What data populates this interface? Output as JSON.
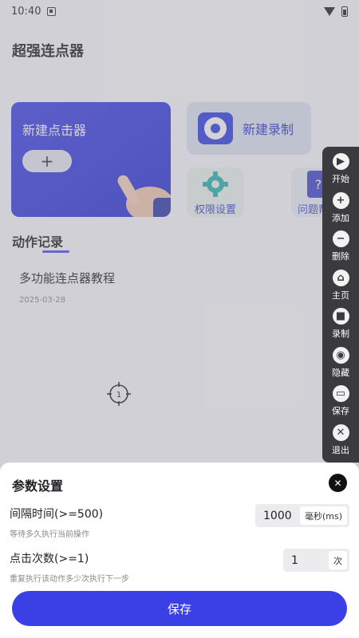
{
  "status_bar": {
    "time": "10:40"
  },
  "app": {
    "title": "超强连点器"
  },
  "cards": {
    "new_clicker": {
      "label": "新建点击器",
      "button": "+"
    },
    "new_record": {
      "label": "新建录制"
    },
    "permissions": {
      "label": "权限设置"
    },
    "faq": {
      "label": "问题帮",
      "icon_glyph": "?"
    }
  },
  "records": {
    "title": "动作记录",
    "items": [
      {
        "name": "多功能连点器教程",
        "date": "2025-03-28"
      }
    ]
  },
  "crosshair_label": "1",
  "floating_bar": {
    "items": [
      {
        "label": "开始",
        "icon": "play-icon",
        "glyph": "▶"
      },
      {
        "label": "添加",
        "icon": "plus-icon",
        "glyph": "+"
      },
      {
        "label": "删除",
        "icon": "minus-icon",
        "glyph": "−"
      },
      {
        "label": "主页",
        "icon": "home-icon",
        "glyph": "⌂"
      },
      {
        "label": "录制",
        "icon": "video-icon",
        "glyph": "■"
      },
      {
        "label": "隐藏",
        "icon": "eye-off-icon",
        "glyph": "◉"
      },
      {
        "label": "保存",
        "icon": "save-icon",
        "glyph": "▭"
      },
      {
        "label": "退出",
        "icon": "close-icon",
        "glyph": "✕"
      }
    ]
  },
  "sheet": {
    "title": "参数设置",
    "close_glyph": "✕",
    "interval": {
      "label": "间隔时间(>=500)",
      "desc": "等待多久执行当前操作",
      "value": "1000",
      "unit": "毫秒(ms)"
    },
    "count": {
      "label": "点击次数(>=1)",
      "desc": "重复执行该动作多少次执行下一步",
      "value": "1",
      "unit": "次"
    },
    "save_label": "保存"
  },
  "colors": {
    "primary": "#3a3fe6",
    "floating_bar": "#3a3a3f"
  }
}
